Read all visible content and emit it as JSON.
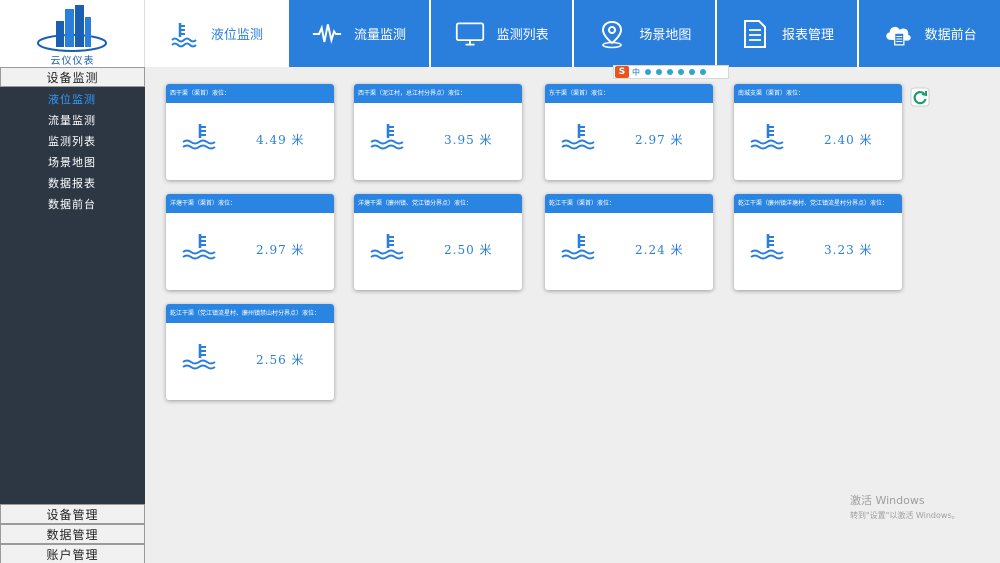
{
  "app": {
    "logo_text": "云仪仪表"
  },
  "colors": {
    "primary": "#2a7fdc",
    "sidebar_bg": "#2d3743",
    "sidebar_active": "#2f9bff",
    "card_header": "#2a85e2"
  },
  "nav": {
    "tabs": [
      {
        "label": "液位监测",
        "icon": "water-level-icon",
        "active": true
      },
      {
        "label": "流量监测",
        "icon": "pulse-icon",
        "active": false
      },
      {
        "label": "监测列表",
        "icon": "monitor-icon",
        "active": false
      },
      {
        "label": "场景地图",
        "icon": "map-pin-icon",
        "active": false
      },
      {
        "label": "报表管理",
        "icon": "document-icon",
        "active": false
      },
      {
        "label": "数据前台",
        "icon": "cloud-data-icon",
        "active": false
      }
    ]
  },
  "sidebar": {
    "section_title": "设备监测",
    "items": [
      {
        "label": "液位监测",
        "active": true
      },
      {
        "label": "流量监测",
        "active": false
      },
      {
        "label": "监测列表",
        "active": false
      },
      {
        "label": "场景地图",
        "active": false
      },
      {
        "label": "数据报表",
        "active": false
      },
      {
        "label": "数据前台",
        "active": false
      }
    ],
    "bottom": [
      {
        "label": "设备管理"
      },
      {
        "label": "数据管理"
      },
      {
        "label": "账户管理"
      }
    ]
  },
  "cards": [
    {
      "title": "西干渠（渠首）液位：",
      "value": "4.49 米"
    },
    {
      "title": "西干渠（泥江村，总江村分界点）液位：",
      "value": "3.95 米"
    },
    {
      "title": "东干渠（渠首）液位：",
      "value": "2.97 米"
    },
    {
      "title": "南城支渠（渠首）液位：",
      "value": "2.40 米"
    },
    {
      "title": "洋塘干渠（渠首）液位：",
      "value": "2.97 米"
    },
    {
      "title": "洋塘干渠（廉州镇、党江镇分界点）液位：",
      "value": "2.50 米"
    },
    {
      "title": "乾江干渠（渠首）液位：",
      "value": "2.24 米"
    },
    {
      "title": "乾江干渠（廉州镇洋塘村、党江镇流星村分界点）液位：",
      "value": "3.23 米"
    },
    {
      "title": "乾江干渠（党江镇流星村、廉州镇禁山村分界点）液位：",
      "value": "2.56 米"
    }
  ],
  "ime": {
    "logo": "S",
    "mode": "中"
  },
  "watermark": {
    "line1": "激活 Windows",
    "line2": "转到\"设置\"以激活 Windows。"
  }
}
